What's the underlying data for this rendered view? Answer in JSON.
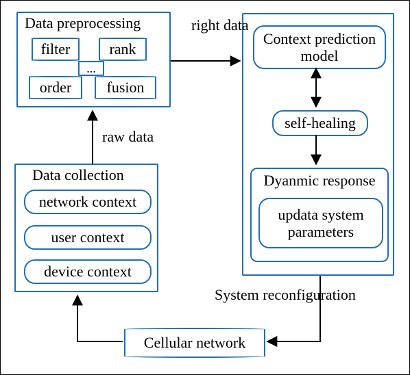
{
  "preprocess": {
    "title": "Data preprocessing",
    "ops": {
      "filter": "filter",
      "rank": "rank",
      "order": "order",
      "fusion": "fusion",
      "ellipsis": "..."
    }
  },
  "collection": {
    "title": "Data collection",
    "network": "network context",
    "user": "user context",
    "device": "device context"
  },
  "right": {
    "prediction": "Context prediction model",
    "selfheal": "self-healing",
    "dynamic_title": "Dyanmic response",
    "update": "updata system parameters"
  },
  "edges": {
    "raw_data": "raw data",
    "right_data": "right data",
    "reconfig": "System reconfiguration"
  },
  "cellular": "Cellular network"
}
